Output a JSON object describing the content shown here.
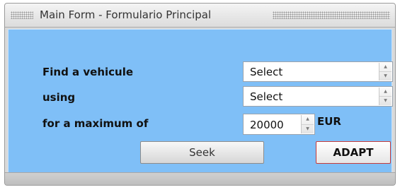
{
  "window": {
    "title": "Main Form - Formulario Principal"
  },
  "form": {
    "vehicle_label": "Find a vehicule",
    "vehicle_select_value": "Select",
    "using_label": "using",
    "using_select_value": "Select",
    "max_label": "for a maximum of",
    "max_value": "20000",
    "currency": "EUR",
    "seek_label": "Seek",
    "adapt_label": "ADAPT"
  },
  "colors": {
    "client_background": "#7fbff7",
    "adapt_border": "#c43c3c"
  },
  "icons": {
    "spinner_up": "triangle-up-icon",
    "spinner_down": "triangle-down-icon",
    "grip": "grip-dots-icon"
  }
}
